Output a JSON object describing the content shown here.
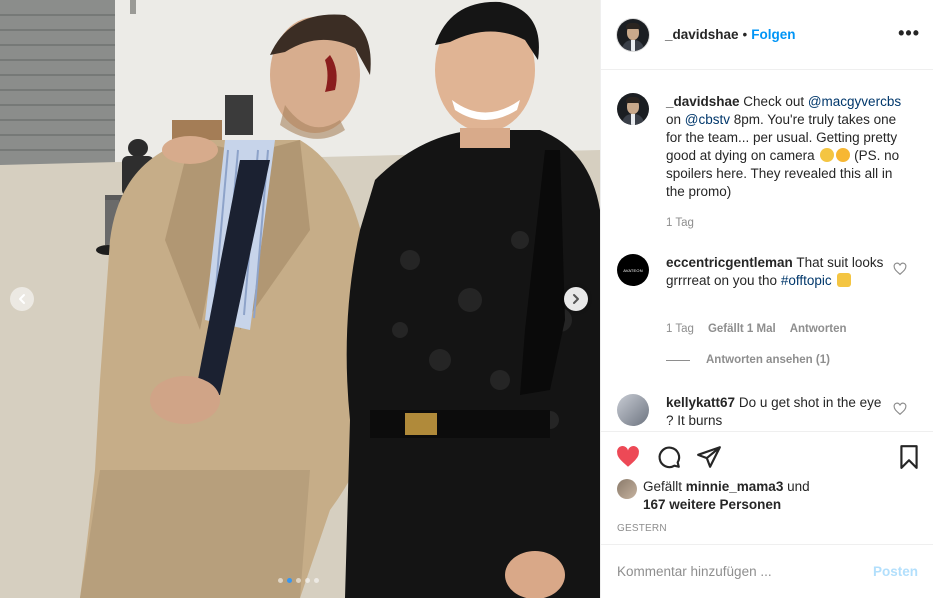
{
  "post": {
    "author": "_davidshae",
    "separator": "•",
    "follow_label": "Folgen",
    "more_label": "•••",
    "caption": {
      "user": "_davidshae",
      "text_1": " Check out ",
      "mention_1": "@macgyvercbs",
      "text_2": " on ",
      "mention_2": "@cbstv",
      "text_3": " 8pm. You're truly takes one for the team... per usual. Getting pretty good at dying on camera ",
      "text_4": " (PS. no spoilers here. They revealed this all in the promo)",
      "time": "1 Tag"
    },
    "comments": [
      {
        "user": "eccentricgentleman",
        "text_1": " That suit looks grrrreat on you tho ",
        "hashtag": "#offtopic",
        "time": "1 Tag",
        "likes": "Gefällt 1 Mal",
        "reply": "Antworten",
        "view_replies": "Antworten ansehen (1)",
        "avatar_text": "AVATEON"
      },
      {
        "user": "kellykatt67",
        "text_1": " Do u get shot in the eye ? It burns"
      }
    ],
    "likes": {
      "prefix": "Gefällt ",
      "user": "minnie_mama3",
      "middle": " und",
      "others": "167 weitere Personen"
    },
    "timestamp": "GESTERN",
    "add_comment_placeholder": "Kommentar hinzufügen ...",
    "post_button": "Posten",
    "carousel": {
      "total": 5,
      "active": 2
    }
  },
  "colors": {
    "link": "#0095f6",
    "heart": "#ed4956",
    "mention": "#00376b",
    "muted": "#8e8e8e",
    "post_disabled": "#b2dffc"
  },
  "icons": [
    "chevron-left-icon",
    "chevron-right-icon",
    "heart-icon",
    "comment-icon",
    "share-icon",
    "bookmark-icon",
    "more-icon"
  ]
}
